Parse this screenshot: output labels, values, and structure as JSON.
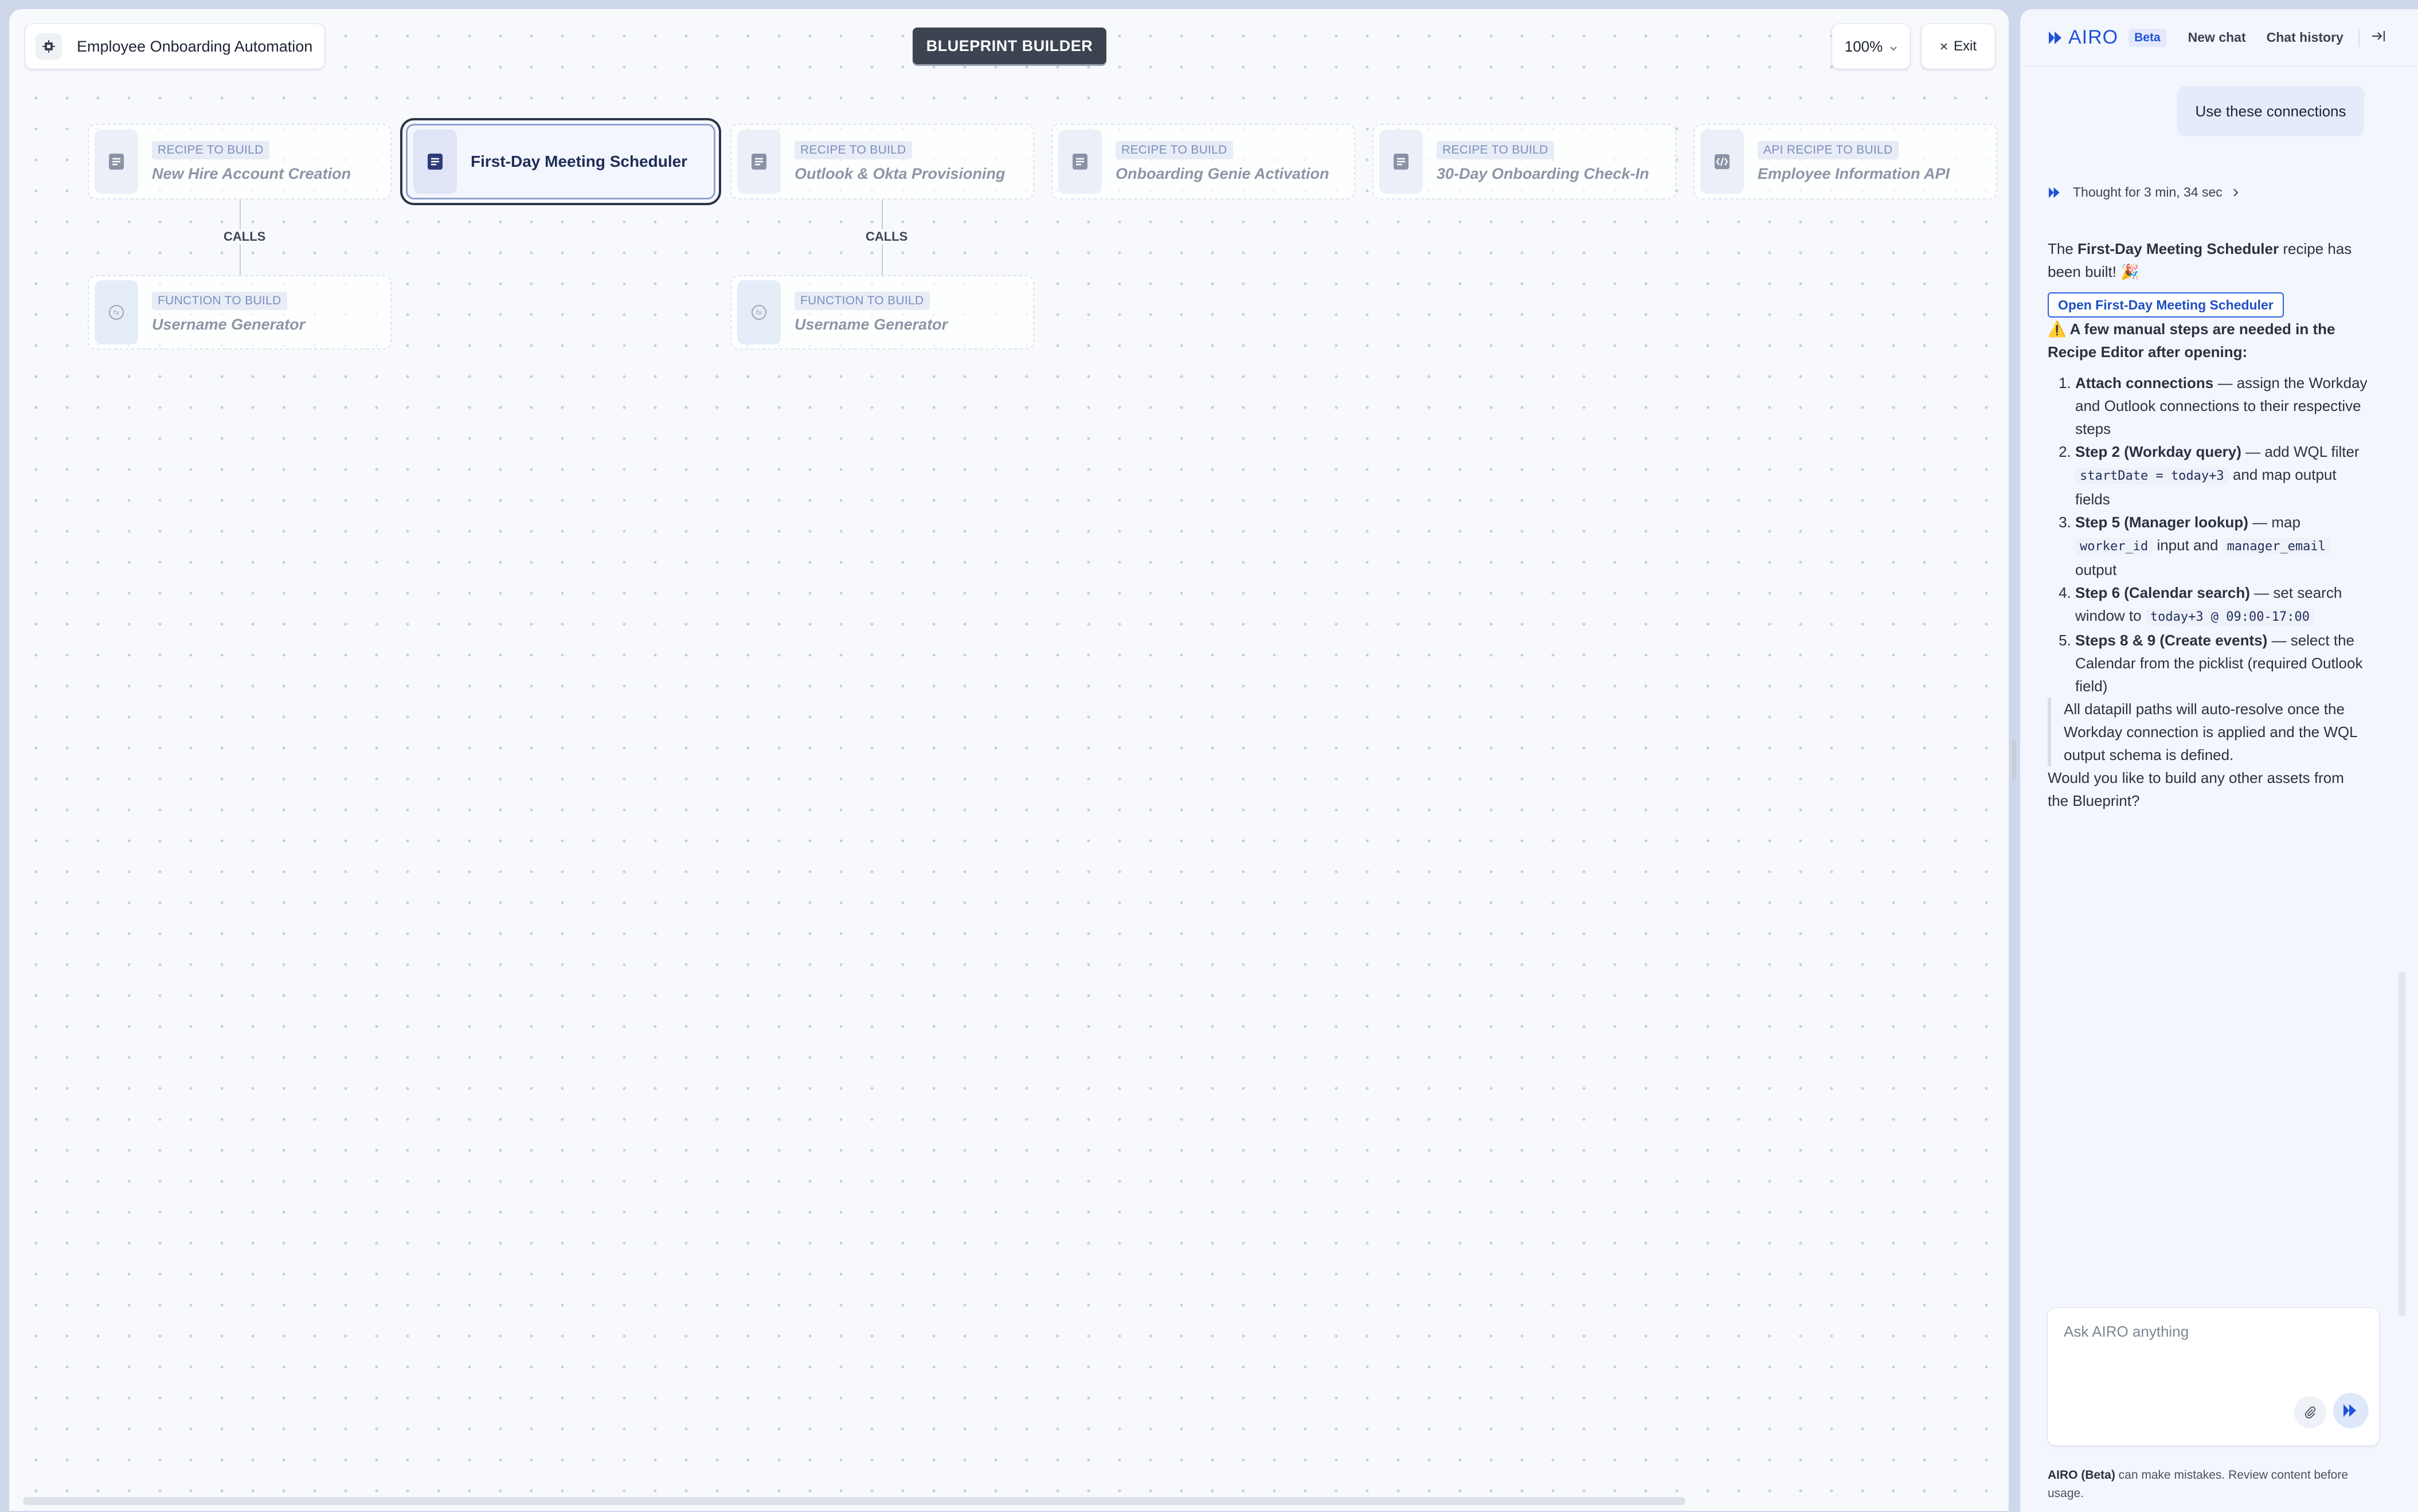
{
  "canvas": {
    "title": "Employee Onboarding Automation",
    "badge": "BLUEPRINT BUILDER",
    "zoom": "100%",
    "exit": "Exit"
  },
  "nodes": [
    {
      "tag": "RECIPE TO BUILD",
      "title": "New Hire Account Creation"
    },
    {
      "tag": "",
      "title": "First-Day Meeting Scheduler"
    },
    {
      "tag": "RECIPE TO BUILD",
      "title": "Outlook & Okta Provisioning"
    },
    {
      "tag": "RECIPE TO BUILD",
      "title": "Onboarding Genie Activation"
    },
    {
      "tag": "RECIPE TO BUILD",
      "title": "30-Day Onboarding Check-In"
    },
    {
      "tag": "API RECIPE TO BUILD",
      "title": "Employee Information API"
    }
  ],
  "functions": [
    {
      "tag": "FUNCTION TO BUILD",
      "title": "Username Generator"
    },
    {
      "tag": "FUNCTION TO BUILD",
      "title": "Username Generator"
    }
  ],
  "calls_label": "CALLS",
  "panel": {
    "brand": "AIRO",
    "beta": "Beta",
    "new_chat": "New chat",
    "chat_history": "Chat history",
    "user_message": "Use these connections",
    "thought": "Thought for 3 min, 34 sec",
    "intro_pre": "The ",
    "intro_bold": "First-Day Meeting Scheduler",
    "intro_post": " recipe has been built! 🎉",
    "open_button": "Open First-Day Meeting Scheduler",
    "warning": "⚠️ A few manual steps are needed in the Recipe Editor after opening:",
    "steps": [
      {
        "bold": "Attach connections",
        "text": " — assign the Workday and Outlook connections to their respective steps"
      },
      {
        "bold": "Step 2 (Workday query)",
        "text": " — add WQL filter ",
        "code": "startDate = today+3",
        "text2": " and map output fields"
      },
      {
        "bold": "Step 5 (Manager lookup)",
        "text": " — map ",
        "code": "worker_id",
        "text2": " input and ",
        "code2": "manager_email",
        "text3": " output"
      },
      {
        "bold": "Step 6 (Calendar search)",
        "text": " — set search window to ",
        "code": "today+3 @ 09:00-17:00"
      },
      {
        "bold": "Steps 8 & 9 (Create events)",
        "text": " — select the Calendar from the picklist (required Outlook field)"
      }
    ],
    "note": "All datapill paths will auto-resolve once the Workday connection is applied and the WQL output schema is defined.",
    "question": "Would you like to build any other assets from the Blueprint?",
    "input_placeholder": "Ask AIRO anything",
    "disclaimer_bold": "AIRO (Beta)",
    "disclaimer_text": " can make mistakes. Review content before usage."
  },
  "colors": {
    "accent": "#1e52d8",
    "badge_bg": "#3c4451",
    "active_border": "#2d3647"
  },
  "icons": [
    "app-icon",
    "recipe-icon",
    "function-icon",
    "api-icon",
    "chevron-down-icon",
    "close-icon",
    "airo-logo-icon",
    "collapse-panel-icon",
    "chevron-right-icon",
    "paperclip-icon",
    "send-icon"
  ]
}
